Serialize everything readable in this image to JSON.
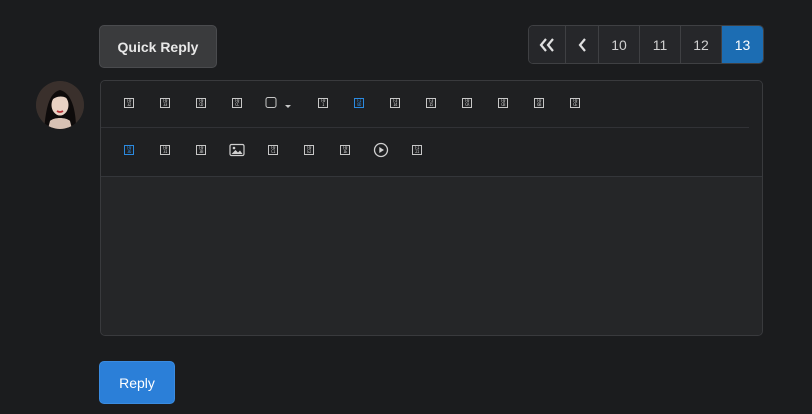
{
  "actions": {
    "quick_reply_label": "Quick Reply",
    "reply_label": "Reply"
  },
  "pagination": {
    "first_icon": "double-chevron-left-icon",
    "prev_icon": "chevron-left-icon",
    "pages": [
      "10",
      "11",
      "12",
      "13"
    ],
    "current": "13",
    "active_color": "#1c6db3"
  },
  "avatar": {
    "icon": "user-avatar"
  },
  "toolbar": {
    "row1": [
      {
        "name": "bold-icon",
        "code": [
          "F0",
          "32"
        ]
      },
      {
        "name": "italic-icon",
        "code": [
          "F0",
          "33"
        ]
      },
      {
        "name": "underline-icon",
        "code": [
          "F0",
          "CD"
        ]
      },
      {
        "name": "strikethrough-icon",
        "code": [
          "F0",
          "CC"
        ]
      },
      {
        "name": "checkbox-dropdown-icon",
        "code": [
          "",
          ""
        ]
      },
      {
        "name": "color-icon",
        "code": [
          "F0",
          "1"
        ]
      },
      {
        "name": "font-size-icon",
        "code": [
          "F1",
          "0D"
        ],
        "active": true
      },
      {
        "name": "list-icon",
        "code": [
          "F3",
          "14"
        ]
      },
      {
        "name": "ordered-list-icon",
        "code": [
          "F3",
          "15"
        ]
      },
      {
        "name": "indent-icon",
        "code": [
          "F0",
          "CA"
        ]
      },
      {
        "name": "outdent-icon",
        "code": [
          "F0",
          "CB"
        ]
      },
      {
        "name": "table-icon",
        "code": [
          "F0",
          "6B"
        ]
      },
      {
        "name": "code-icon",
        "code": [
          "F0",
          "CE"
        ]
      }
    ],
    "row2": [
      {
        "name": "link-icon",
        "code": [
          "F0",
          "36"
        ],
        "active": true
      },
      {
        "name": "unlink-icon",
        "code": [
          "F0",
          "31"
        ]
      },
      {
        "name": "quote-icon",
        "code": [
          "F0",
          "3B"
        ]
      },
      {
        "name": "image-icon",
        "code": [
          "",
          ""
        ]
      },
      {
        "name": "align-icon",
        "code": [
          "F0",
          "C1"
        ]
      },
      {
        "name": "smiley-icon",
        "code": [
          "F0",
          "E2"
        ]
      },
      {
        "name": "spoiler-icon",
        "code": [
          "F0",
          "1E"
        ]
      },
      {
        "name": "media-icon",
        "code": [
          "",
          ""
        ]
      },
      {
        "name": "more-icon",
        "code": [
          "F1",
          "21"
        ]
      }
    ]
  }
}
